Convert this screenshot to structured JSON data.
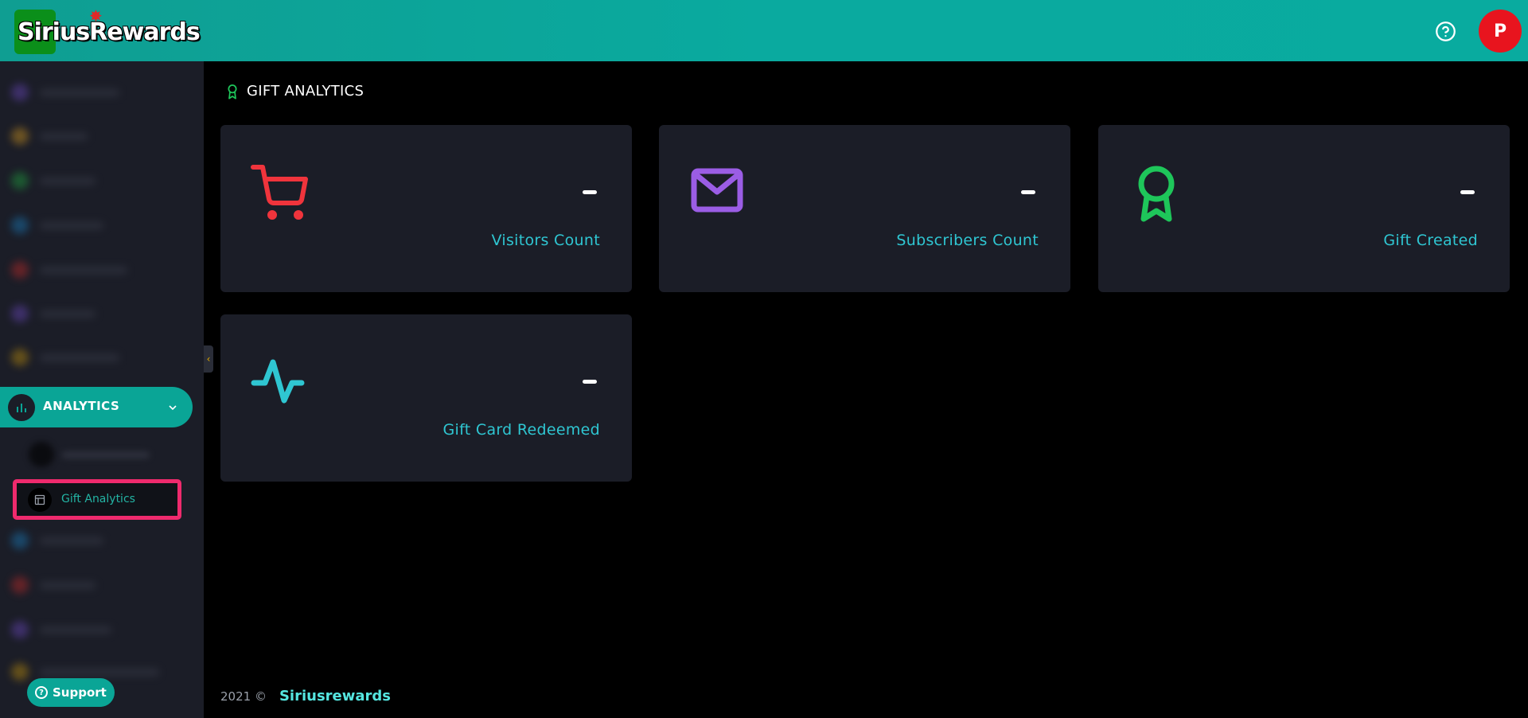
{
  "header": {
    "logo_text": "SiriusRewards",
    "avatar_initial": "P"
  },
  "sidebar": {
    "analytics_label": "ANALYTICS",
    "active_sub_item_label": "Gift Analytics",
    "support_label": "Support"
  },
  "page": {
    "title": "GIFT ANALYTICS"
  },
  "cards": [
    {
      "label": "Visitors Count",
      "value": "—",
      "icon": "cart-icon",
      "color": "#f0343c"
    },
    {
      "label": "Subscribers Count",
      "value": "—",
      "icon": "mail-icon",
      "color": "#9b5de5"
    },
    {
      "label": "Gift Created",
      "value": "—",
      "icon": "award-icon",
      "color": "#1ec65a"
    },
    {
      "label": "Gift Card Redeemed",
      "value": "—",
      "icon": "activity-icon",
      "color": "#2fc6d2"
    }
  ],
  "footer": {
    "year": "2021 ©",
    "brand": "Siriusrewards"
  },
  "colors": {
    "header": "#0aa596",
    "sidebar": "#1b1d27",
    "card": "#1b1d27",
    "accent": "#2fc6d2",
    "highlight": "#ef2a6d"
  }
}
